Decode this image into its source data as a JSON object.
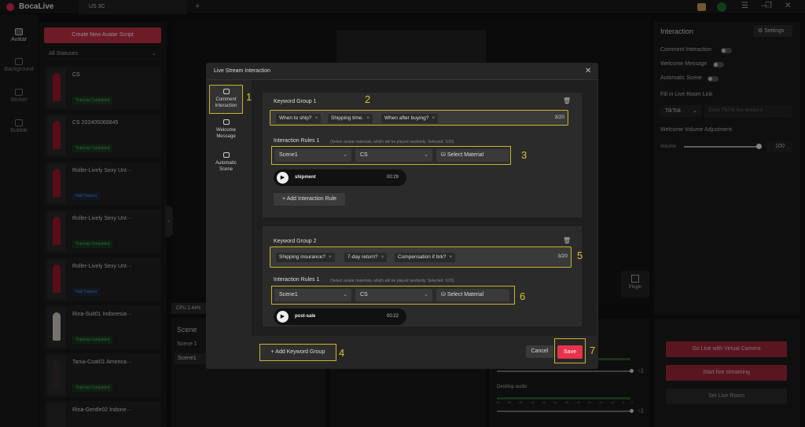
{
  "app": {
    "name": "BocaLive",
    "tab": "US 3C",
    "tab_add": "+"
  },
  "rail": [
    {
      "label": "Avatar"
    },
    {
      "label": "Background"
    },
    {
      "label": "Sticker"
    },
    {
      "label": "Bubble"
    }
  ],
  "avatar_list": {
    "create_label": "Create New Avatar Script",
    "filter": "All Statuses",
    "items": [
      {
        "name": "CS",
        "status": "Training Completed"
      },
      {
        "name": "CS 202405068845",
        "status": "Training Completed"
      },
      {
        "name": "Roller-Lively Sexy Unt···",
        "status": "Half Trained"
      },
      {
        "name": "Roller-Lively Sexy Unt···",
        "status": "Training Completed"
      },
      {
        "name": "Roller-Lively Sexy Unt···",
        "status": "Half Trained"
      },
      {
        "name": "Rina-Suit01 Indonesia···",
        "status": "Training Completed"
      },
      {
        "name": "Tania-Coat01 America···",
        "status": "Training Completed"
      },
      {
        "name": "Rina-Gentle02 Indone···",
        "status": "Training Completed"
      }
    ]
  },
  "stage": {
    "cpu": "CPU 2.44%",
    "scene_title": "Scene",
    "scenes": [
      "Scene 1",
      "Scene1"
    ],
    "plugin_label": "Plugin",
    "desktop_audio": "Desktop audio",
    "meter_ticks": [
      "-60",
      "-55",
      "-50",
      "-45",
      "-40",
      "-35",
      "-30",
      "-25",
      "-20",
      "-15",
      "-10",
      "-5",
      "0"
    ]
  },
  "interaction_panel": {
    "title": "Interaction",
    "settings_label": "Settings",
    "comment_interaction": "Comment Interaction",
    "welcome_message": "Welcome Message",
    "automatic_scene": "Automatic Scene",
    "fill_link_label": "Fill in Live Room Link",
    "platform": "TikTok",
    "link_placeholder": "Enter TikTok live stream li",
    "welcome_volume_label": "Welcome Volume Adjustment",
    "volume_label": "Volume",
    "volume_value": "100",
    "volume_level": 1.0
  },
  "live_buttons": {
    "virtual_camera": "Go Live with Virtual Camera",
    "start_streaming": "Start live streaming",
    "set_room": "Set Live Room"
  },
  "modal": {
    "title": "Live Stream Interaction",
    "nav": [
      {
        "label1": "Comment",
        "label2": "Interaction"
      },
      {
        "label1": "Welcome",
        "label2": "Message"
      },
      {
        "label1": "Automatic",
        "label2": "Scene"
      }
    ],
    "groups": [
      {
        "title": "Keyword Group 1",
        "keywords": [
          "When to ship?",
          "Shipping time.",
          "When after buying?"
        ],
        "count": "3/20",
        "rules_label": "Interaction Rules 1",
        "rules_hint": "(Select avatar materials, which will be played randomly. Selected: 1/20)",
        "scene": "Scene1",
        "avatar": "CS",
        "select_material": "Select Material",
        "material_name": "shipment",
        "material_duration": "00:29",
        "add_rule_label": "Add Interaction Rule"
      },
      {
        "title": "Keyword Group 2",
        "keywords": [
          "Shipping insurance?",
          "7-day return?",
          "Compensation if brk?"
        ],
        "count": "3/20",
        "rules_label": "Interaction Rules 1",
        "rules_hint": "(Select avatar materials, which will be played randomly. Selected: 1/20)",
        "scene": "Scene1",
        "avatar": "CS",
        "select_material": "Select Material",
        "material_name": "post-sale",
        "material_duration": "00:22"
      }
    ],
    "add_group_label": "Add Keyword Group",
    "cancel_label": "Cancel",
    "save_label": "Save"
  },
  "annotations": [
    "1",
    "2",
    "3",
    "4",
    "5",
    "6",
    "7"
  ],
  "colors": {
    "accent_red": "#e7334d",
    "highlight_yellow": "#c8b52e",
    "badge_green": "#4fbf62"
  }
}
